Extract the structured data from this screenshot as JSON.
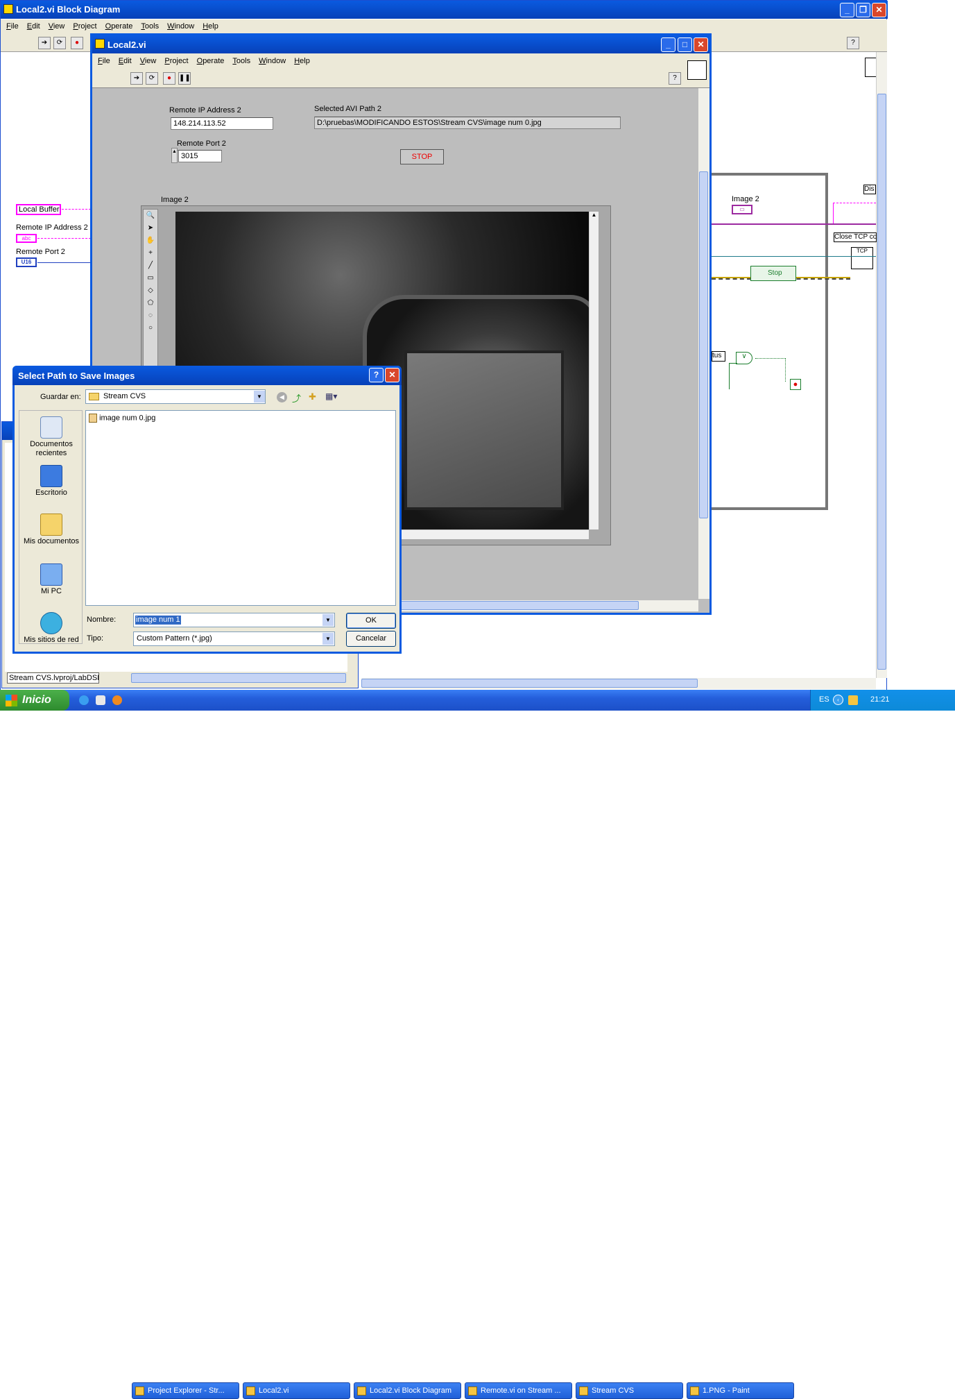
{
  "bd": {
    "title": "Local2.vi Block Diagram",
    "menu": [
      "File",
      "Edit",
      "View",
      "Project",
      "Operate",
      "Tools",
      "Window",
      "Help"
    ],
    "labels": {
      "local_buffer": "Local Buffer",
      "remote_ip": "Remote IP Address 2",
      "remote_port": "Remote Port 2",
      "abc": "abc",
      "u16": "U16",
      "image2": "Image 2",
      "close_tcp": "Close TCP co",
      "dis": "Dis",
      "stop": "Stop",
      "tus": "tus"
    }
  },
  "fp": {
    "title": "Local2.vi",
    "menu": [
      "File",
      "Edit",
      "View",
      "Project",
      "Operate",
      "Tools",
      "Window",
      "Help"
    ],
    "ip_label": "Remote IP Address 2",
    "ip_value": "148.214.113.52",
    "path_label": "Selected AVI Path 2",
    "path_value": "D:\\pruebas\\MODIFICANDO ESTOS\\Stream CVS\\image num 0.jpg",
    "port_label": "Remote Port 2",
    "port_value": "3015",
    "stop_label": "STOP",
    "image_label": "Image 2"
  },
  "pe": {
    "path": "Stream CVS.lvproj/LabDSP"
  },
  "dialog": {
    "title": "Select Path to Save Images",
    "save_in_label": "Guardar en:",
    "folder": "Stream CVS",
    "files": [
      "image num 0.jpg"
    ],
    "places": [
      "Documentos recientes",
      "Escritorio",
      "Mis documentos",
      "Mi PC",
      "Mis sitios de red"
    ],
    "name_label": "Nombre:",
    "name_value": "image num 1",
    "type_label": "Tipo:",
    "type_value": "Custom Pattern (*.jpg)",
    "ok": "OK",
    "cancel": "Cancelar"
  },
  "taskbar": {
    "start": "Inicio",
    "tasks": [
      "Project Explorer - Str...",
      "Local2.vi",
      "Local2.vi Block Diagram",
      "Remote.vi on Stream ...",
      "Stream CVS",
      "1.PNG - Paint"
    ],
    "lang": "ES",
    "clock": "21:21"
  },
  "colors": {
    "xp_blue": "#0a5ae0",
    "lv_gray": "#bdbdbd",
    "pink": "#ff00ff",
    "wire_blue": "#2040c0",
    "wire_green": "#1a7d2c"
  }
}
